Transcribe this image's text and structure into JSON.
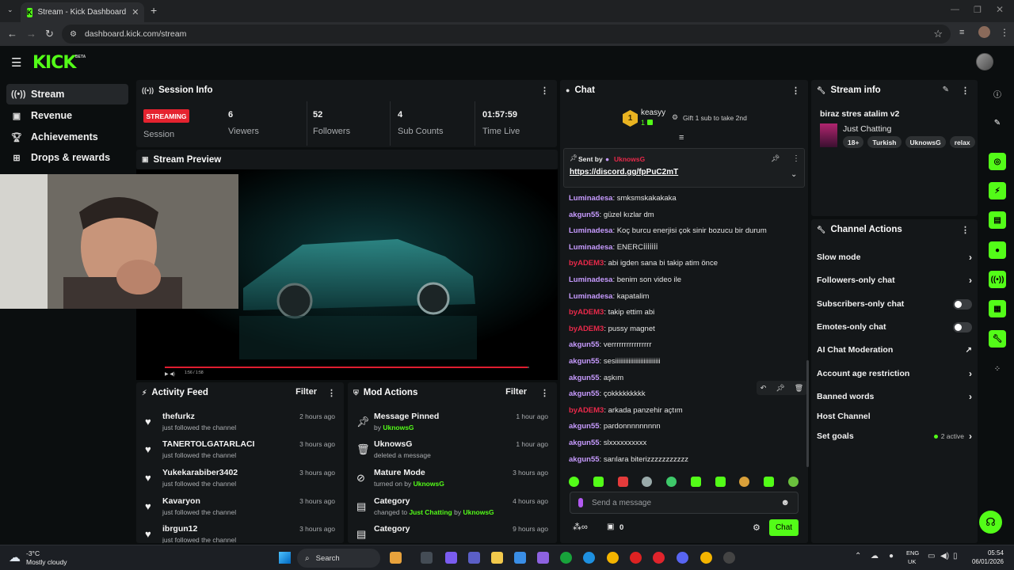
{
  "browser": {
    "tab_title": "Stream - Kick Dashboard",
    "favicon_letter": "K",
    "url": "dashboard.kick.com/stream"
  },
  "brand": {
    "logo": "KICK",
    "beta": "BETA",
    "accent": "#53fc18"
  },
  "sidebar": {
    "items": [
      {
        "label": "Stream",
        "icon": "broadcast-icon"
      },
      {
        "label": "Revenue",
        "icon": "wallet-icon"
      },
      {
        "label": "Achievements",
        "icon": "trophy-icon"
      },
      {
        "label": "Drops & rewards",
        "icon": "gift-icon"
      }
    ]
  },
  "session": {
    "title": "Session Info",
    "status_badge": "STREAMING",
    "status_label": "Session",
    "stats": [
      {
        "value": "6",
        "label": "Viewers"
      },
      {
        "value": "52",
        "label": "Followers"
      },
      {
        "value": "4",
        "label": "Sub Counts"
      },
      {
        "value": "01:57:59",
        "label": "Time Live"
      }
    ]
  },
  "preview": {
    "title": "Stream Preview",
    "player_time": "1:56 / 1:58",
    "progress": 0.99
  },
  "activity": {
    "title": "Activity Feed",
    "filter": "Filter",
    "items": [
      {
        "name": "thefurkz",
        "sub": "just followed the channel",
        "time": "2 hours ago"
      },
      {
        "name": "TANERTOLGATARLACI",
        "sub": "just followed the channel",
        "time": "3 hours ago"
      },
      {
        "name": "Yukekarabiber3402",
        "sub": "just followed the channel",
        "time": "3 hours ago"
      },
      {
        "name": "Kavaryon",
        "sub": "just followed the channel",
        "time": "3 hours ago"
      },
      {
        "name": "ibrgun12",
        "sub": "just followed the channel",
        "time": "3 hours ago"
      }
    ]
  },
  "mod": {
    "title": "Mod Actions",
    "filter": "Filter",
    "items": [
      {
        "name": "Message Pinned",
        "sub_pre": "by ",
        "sub_user": "UknowsG",
        "sub_mid": "",
        "sub_user2": "",
        "time": "1 hour ago",
        "icon": "pin-icon"
      },
      {
        "name": "UknowsG",
        "sub_pre": "deleted a message",
        "sub_user": "",
        "sub_mid": "",
        "sub_user2": "",
        "time": "1 hour ago",
        "icon": "trash-icon"
      },
      {
        "name": "Mature Mode",
        "sub_pre": "turned on by ",
        "sub_user": "UknowsG",
        "sub_mid": "",
        "sub_user2": "",
        "time": "3 hours ago",
        "icon": "eye-off-icon"
      },
      {
        "name": "Category",
        "sub_pre": "changed to ",
        "sub_user": "Just Chatting",
        "sub_mid": " by ",
        "sub_user2": "UknowsG",
        "time": "4 hours ago",
        "icon": "category-icon"
      },
      {
        "name": "Category",
        "sub_pre": "",
        "sub_user": "",
        "sub_mid": "",
        "sub_user2": "",
        "time": "9 hours ago",
        "icon": "category-icon"
      }
    ]
  },
  "chat": {
    "title": "Chat",
    "leader_name": "keasyy",
    "leader_rank": "1",
    "leader_count": "1",
    "gift_text": "Gift 1 sub to take 2nd",
    "pinned_by_label": "Sent by",
    "pinned_by_user": "UknowsG",
    "pinned_link": "https://discord.gg/fpPuC2mT",
    "messages": [
      {
        "user": "Luminadesa",
        "text": "smksmskakakaka",
        "color": "#c79bff"
      },
      {
        "user": "akgun55",
        "text": "güzel kızlar dm",
        "color": "#c79bff"
      },
      {
        "user": "Luminadesa",
        "text": "Koç burcu enerjisi çok sinir bozucu bir durum",
        "color": "#c79bff"
      },
      {
        "user": "Luminadesa",
        "text": "ENERCİİİİİİİ",
        "color": "#c79bff"
      },
      {
        "user": "byADEM3",
        "text": "abi igden sana bi takip atim önce",
        "color": "#e8294a"
      },
      {
        "user": "Luminadesa",
        "text": "benim son video ile",
        "color": "#c79bff"
      },
      {
        "user": "Luminadesa",
        "text": "kapatalim",
        "color": "#c79bff"
      },
      {
        "user": "byADEM3",
        "text": "takip ettim abi",
        "color": "#e8294a"
      },
      {
        "user": "byADEM3",
        "text": "pussy magnet",
        "color": "#e8294a"
      },
      {
        "user": "akgun55",
        "text": "verrrrrrrrrrrrrrrr",
        "color": "#c79bff"
      },
      {
        "user": "akgun55",
        "text": "sesiiiiiiiiiiiiiiiiiiiiiiiiiii",
        "color": "#c79bff"
      },
      {
        "user": "akgun55",
        "text": "aşkım",
        "color": "#c79bff"
      },
      {
        "user": "akgun55",
        "text": "çokkkkkkkkk",
        "color": "#c79bff"
      },
      {
        "user": "byADEM3",
        "text": "arkada panzehir açtım",
        "color": "#e8294a"
      },
      {
        "user": "akgun55",
        "text": "pardonnnnnnnnn",
        "color": "#c79bff"
      },
      {
        "user": "akgun55",
        "text": "slxxxxxxxxxx",
        "color": "#c79bff"
      },
      {
        "user": "akgun55",
        "text": "sarılara biterizzzzzzzzzzz",
        "color": "#c79bff"
      }
    ],
    "input_placeholder": "Send a message",
    "points": "0",
    "send_label": "Chat"
  },
  "stream_info": {
    "title": "Stream info",
    "stream_title": "biraz stres atalim v2",
    "category": "Just Chatting",
    "tags": [
      "18+",
      "Turkish",
      "UknowsG",
      "relax"
    ]
  },
  "channel_actions": {
    "title": "Channel Actions",
    "items": [
      {
        "label": "Slow mode",
        "control": "chevron"
      },
      {
        "label": "Followers-only chat",
        "control": "chevron"
      },
      {
        "label": "Subscribers-only chat",
        "control": "toggle"
      },
      {
        "label": "Emotes-only chat",
        "control": "toggle"
      },
      {
        "label": "AI Chat Moderation",
        "control": "external"
      },
      {
        "label": "Account age restriction",
        "control": "chevron"
      },
      {
        "label": "Banned words",
        "control": "chevron"
      },
      {
        "label": "Host Channel",
        "control": "none"
      },
      {
        "label": "Set goals",
        "control": "chevron"
      }
    ],
    "goals_status": "2 active"
  },
  "taskbar": {
    "weather_temp": "-3°C",
    "weather_desc": "Mostly cloudy",
    "search_label": "Search",
    "lang": "ENG",
    "region": "UK",
    "time": "05:54",
    "date": "06/01/2026"
  }
}
